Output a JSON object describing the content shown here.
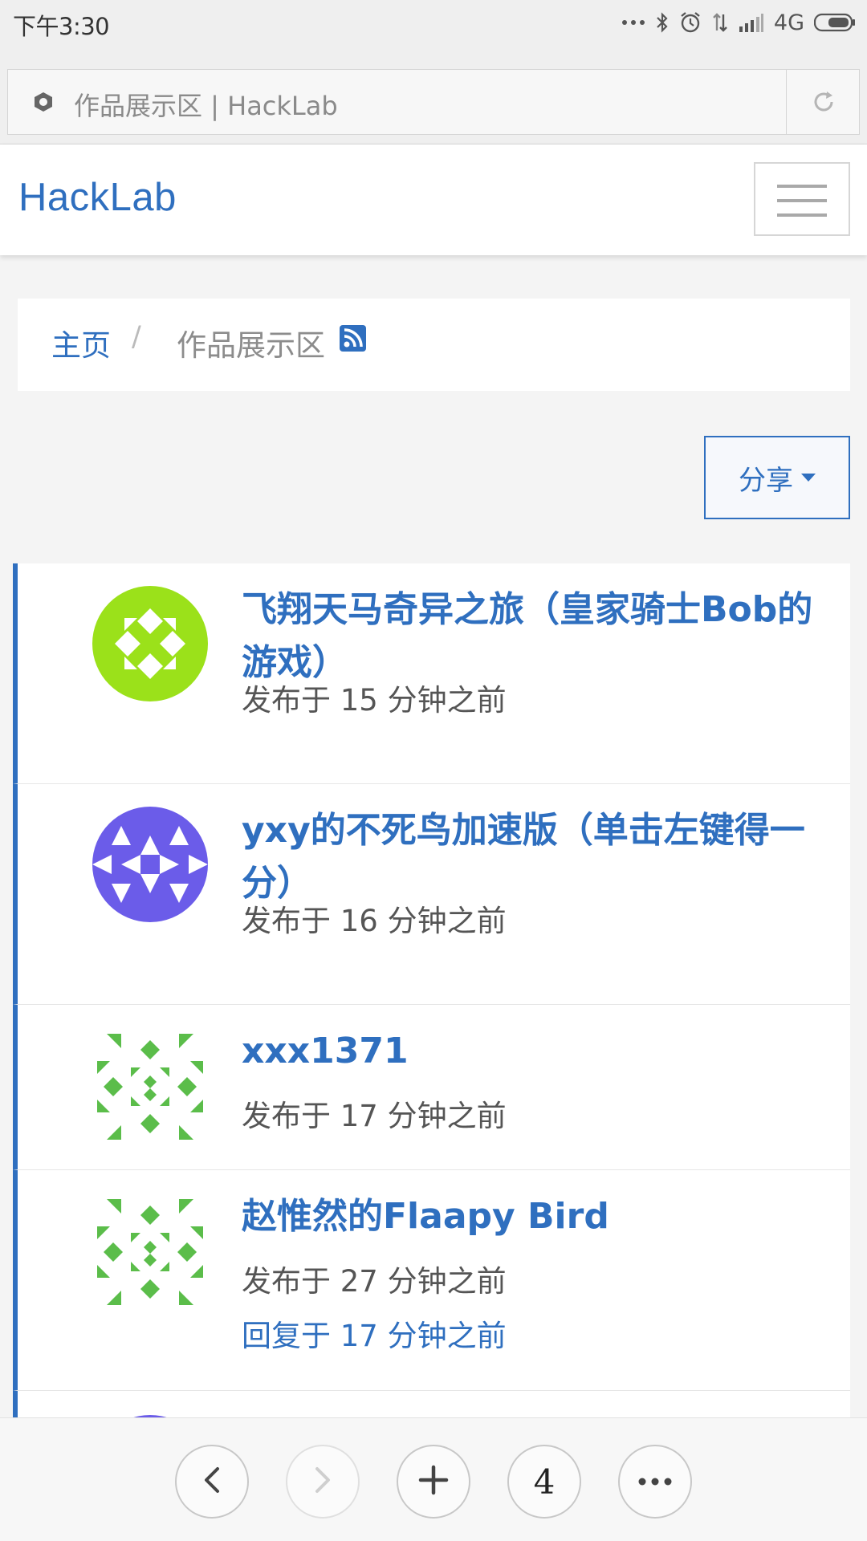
{
  "status_bar": {
    "time": "下午3:30",
    "network": "4G",
    "icons": [
      "more-dots-icon",
      "bluetooth-icon",
      "alarm-icon",
      "data-transfer-icon",
      "signal-icon",
      "battery-icon"
    ]
  },
  "browser": {
    "url_text": "作品展示区 | HackLab",
    "icons": [
      "site-info-icon",
      "reload-icon"
    ]
  },
  "navbar": {
    "brand": "HackLab",
    "icons": [
      "hamburger-menu-icon"
    ]
  },
  "breadcrumb": {
    "home": "主页",
    "separator": "/",
    "current": "作品展示区",
    "icons": [
      "rss-icon"
    ]
  },
  "share": {
    "label": "分享"
  },
  "topics": [
    {
      "title": "飞翔天马奇异之旅（皇家骑士Bob的游戏）",
      "meta": "发布于 15 分钟之前",
      "reply": "",
      "avatar_color": "#9be11a",
      "avatar_icon": "identicon-avatar"
    },
    {
      "title": "yxy的不死鸟加速版（单击左键得一分）",
      "meta": "发布于 16 分钟之前",
      "reply": "",
      "avatar_color": "#6b5ce9",
      "avatar_icon": "identicon-avatar"
    },
    {
      "title": "xxx1371",
      "meta": "发布于 17 分钟之前",
      "reply": "",
      "avatar_color": "#5bbd4a",
      "avatar_icon": "identicon-avatar"
    },
    {
      "title": "赵惟然的Flaapy Bird",
      "meta": "发布于 27 分钟之前",
      "reply": "回复于 17 分钟之前",
      "avatar_color": "#5bbd4a",
      "avatar_icon": "identicon-avatar"
    }
  ],
  "bottom_bar": {
    "tab_count": "4",
    "icons": [
      "back-icon",
      "forward-icon",
      "new-tab-icon",
      "tabs-icon",
      "more-icon"
    ]
  },
  "colors": {
    "accent": "#2f6fbf",
    "page_background": "#f4f4f4"
  }
}
